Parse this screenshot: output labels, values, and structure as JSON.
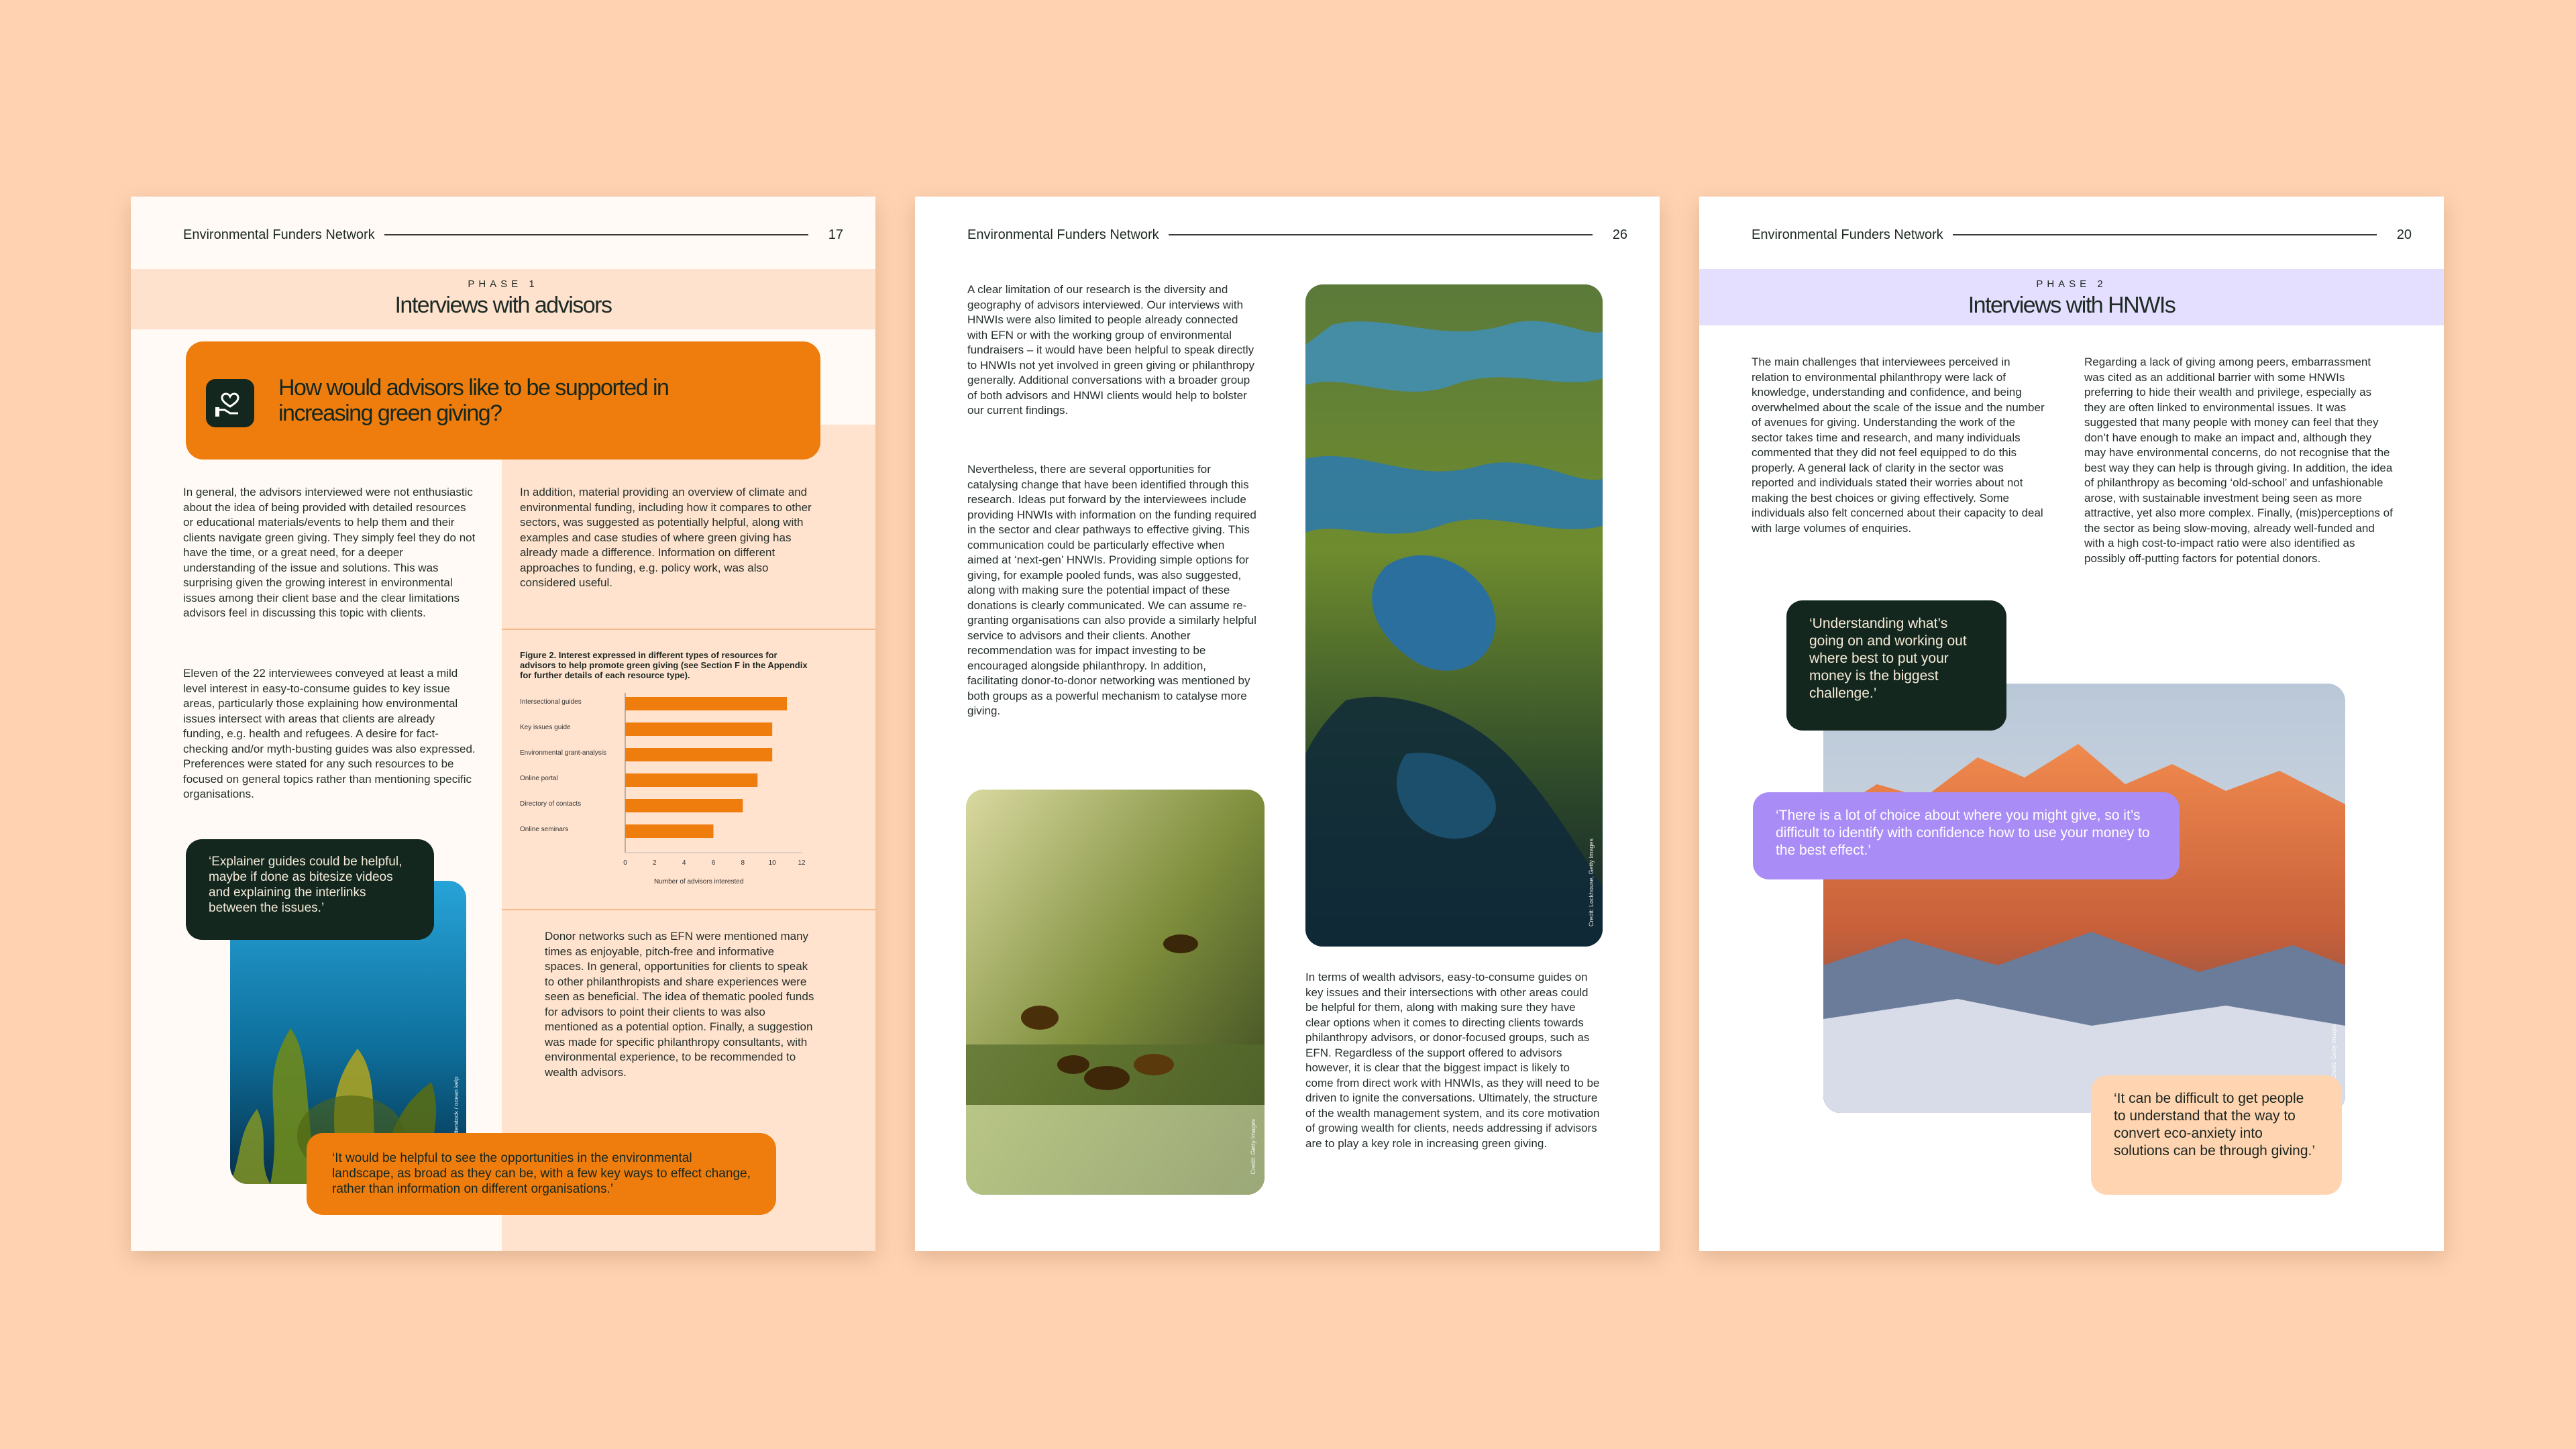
{
  "header": {
    "org": "Environmental Funders Network"
  },
  "colors": {
    "background": "#ffd3b2",
    "orange": "#ef7d0e",
    "dark_green": "#13271f",
    "lavender": "#e4deff",
    "purple": "#a98cf5",
    "peach": "#ffd4b0"
  },
  "page1": {
    "page_number": "17",
    "phase": "PHASE 1",
    "title": "Interviews with advisors",
    "callout_icon": "hand-heart-icon",
    "callout": "How would advisors like to be supported in increasing green giving?",
    "col1_p1": "In general, the advisors interviewed were not enthusiastic about the idea of being provided with detailed resources or educational materials/events to help them and their clients navigate green giving. They simply feel they do not have the time, or a great need, for a deeper understanding of the issue and solutions. This was surprising given the growing interest in environmental issues among their client base and the clear limitations advisors feel in discussing this topic with clients.",
    "col1_p2": "Eleven of the 22 interviewees conveyed at least a mild level interest in easy-to-consume guides to key issue areas, particularly those explaining how environmental issues intersect with areas that clients are already funding, e.g. health and refugees. A desire for fact-checking and/or myth-busting guides was also expressed. Preferences were stated for any such resources to be focused on general topics rather than mentioning specific organisations.",
    "col2_p1": "In addition, material providing an overview of climate and environmental funding, including how it compares to other sectors, was suggested as potentially helpful, along with examples and case studies of where green giving has already made a difference. Information on different approaches to funding, e.g. policy work, was also considered useful.",
    "col2_p2": "Donor networks such as EFN were mentioned many times as enjoyable, pitch-free and informative spaces. In general, opportunities for clients to speak to other philanthropists and share experiences were seen as beneficial. The idea of thematic pooled funds for advisors to point their clients to was also mentioned as a potential option. Finally, a suggestion was made for specific philanthropy consultants, with environmental experience, to be recommended to wealth advisors.",
    "quote1": "‘Explainer guides could be helpful, maybe if done as bitesize videos and explaining the interlinks between the issues.’",
    "quote2": "‘It would be helpful to see the opportunities in the environmental landscape, as broad as they can be, with a few key ways to effect change, rather than information on different organisations.’",
    "photo_credit": "Credit: Shutterstock / ocean kelp"
  },
  "chart_data": {
    "type": "bar",
    "orientation": "horizontal",
    "title": "Figure 2. Interest expressed in different types of resources for advisors to help promote green giving (see Section F in the Appendix for further details of each resource type).",
    "categories": [
      "Intersectional guides",
      "Key issues guide",
      "Environmental grant-analysis",
      "Online portal",
      "Directory of contacts",
      "Online seminars"
    ],
    "values": [
      11,
      10,
      10,
      9,
      8,
      6
    ],
    "xlabel": "Number of advisors interested",
    "xlim": [
      0,
      12
    ],
    "xticks": [
      "0",
      "2",
      "4",
      "6",
      "8",
      "10",
      "12"
    ],
    "bar_color": "#ef7d0e"
  },
  "page2": {
    "page_number": "26",
    "p1": "A clear limitation of our research is the diversity and geography of advisors interviewed. Our interviews with HNWIs were also limited to people already connected with EFN or with the working group of environmental fundraisers – it would have been helpful to speak directly to HNWIs not yet involved in green giving or philanthropy generally. Additional conversations with a broader group of both advisors and HNWI clients would help to bolster our current findings.",
    "p2": "Nevertheless, there are several opportunities for catalysing change that have been identified through this research. Ideas put forward by the interviewees include providing HNWIs with information on the funding required in the sector and clear pathways to effective giving. This communication could be particularly effective when aimed at ‘next-gen’ HNWIs. Providing simple options for giving, for example pooled funds, was also suggested, along with making sure the potential impact of these donations is clearly communicated. We can assume re-granting organisations can also provide a similarly helpful service to advisors and their clients. Another recommendation was for impact investing to be encouraged alongside philanthropy. In addition, facilitating donor-to-donor networking was mentioned by both groups as a powerful mechanism to catalyse more giving.",
    "p3": "In terms of wealth advisors, easy-to-consume guides on key issues and their intersections with other areas could be helpful for them, along with making sure they have clear options when it comes to directing clients towards philanthropy advisors, or donor-focused groups, such as EFN. Regardless of the support offered to advisors however, it is clear that the biggest impact is likely to come from direct work with HNWIs, as they will need to be driven to ignite the conversations. Ultimately, the structure of the wealth management system, and its core motivation of growing wealth for clients, needs addressing if advisors are to play a key role in increasing green giving.",
    "credit_wetland": "Credit: Lockhouse, Getty Images",
    "credit_bees": "Credit: Getty Images"
  },
  "page3": {
    "page_number": "20",
    "phase": "PHASE 2",
    "title": "Interviews with HNWIs",
    "col1": "The main challenges that interviewees perceived in relation to environmental philanthropy were lack of knowledge, understanding and confidence, and being overwhelmed about the scale of the issue and the number of avenues for giving. Understanding the work of the sector takes time and research, and many individuals commented that they did not feel equipped to do this properly. A general lack of clarity in the sector was reported and individuals stated their worries about not making the best choices or giving effectively. Some individuals also felt concerned about their capacity to deal with large volumes of enquiries.",
    "col2": "Regarding a lack of giving among peers, embarrassment was cited as an additional barrier with some HNWIs preferring to hide their wealth and privilege, especially as they are often linked to environmental issues. It was suggested that many people with money can feel that they don’t have enough to make an impact and, although they may have environmental concerns, do not recognise that the best way they can help is through giving. In addition, the idea of philanthropy as becoming ‘old-school’ and unfashionable arose, with sustainable investment being seen as more attractive, yet also more complex. Finally, (mis)perceptions of the sector as being slow-moving, already well-funded and with a high cost-to-impact ratio were also identified as possibly off-putting factors for potential donors.",
    "quote1": "‘Understanding what’s going on and working out where best to put your money is the biggest challenge.’",
    "quote2": "‘There is a lot of choice about where you might give, so it’s difficult to identify with confidence how to use your money to the best effect.’",
    "quote3": "‘It can be difficult to get people to understand that the way to convert eco-anxiety into solutions can be through giving.’",
    "credit_mountain": "Credit: Getty Images"
  }
}
